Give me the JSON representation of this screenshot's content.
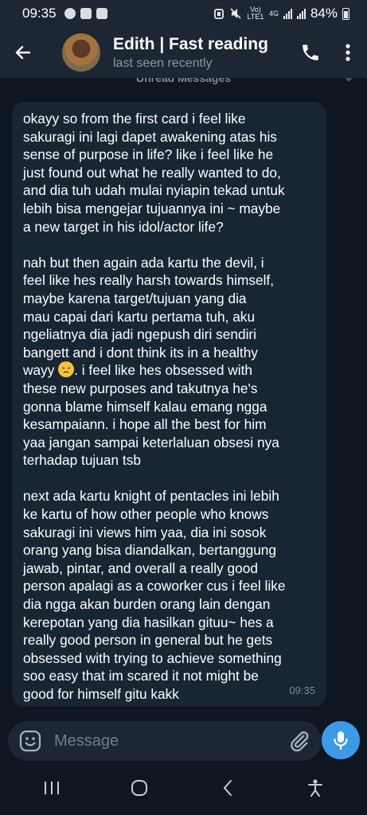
{
  "status_bar": {
    "time": "09:35",
    "network_label": "4G",
    "volte_label": "Vo) LTE1",
    "battery": "84%"
  },
  "header": {
    "title": "Edith | Fast reading",
    "subtitle": "last seen recently"
  },
  "chat": {
    "unread_banner": "Unread Messages",
    "message": {
      "paragraphs": [
        "okayy so from the first card i feel like\nsakuragi ini lagi dapet awakening atas his\nsense of purpose in life? like i feel like he\njust found out what he really wanted to do,\nand dia tuh udah mulai nyiapin tekad untuk\nlebih bisa mengejar tujuannya ini ~ maybe\na new target in his idol/actor life?",
        "nah but then again ada kartu the devil, i\nfeel like hes really harsh towards himself,\nmaybe karena target/tujuan yang dia\nmau capai dari kartu pertama tuh, aku\nngeliatnya dia jadi ngepush diri sendiri\nbangett and i dont think its in a healthy",
        "these new purposes and takutnya he's\ngonna blame himself kalau emang ngga\nkesampaiann. i hope all the best for him\nyaa jangan sampai keterlaluan obsesi nya\nterhadap tujuan tsb",
        "next ada kartu knight of pentacles ini lebih\nke kartu of how other people who knows\nsakuragi ini views him yaa, dia ini sosok\norang yang bisa diandalkan, bertanggung\njawab, pintar, and overall a really good\nperson apalagi as a coworker cus i feel like\ndia ngga akan burden orang lain dengan\nkerepotan yang dia hasilkan gituu~ hes a\nreally good person in general but he gets\nobsessed with trying to achieve something\nsoo easy that im scared it not might be\ngood for himself gitu kakk"
      ],
      "inline_before_emoji": "wayy ",
      "inline_after_emoji": ". i feel like hes obsessed with",
      "time": "09:35"
    }
  },
  "composer": {
    "placeholder": "Message"
  },
  "colors": {
    "accent": "#3e9ae8",
    "header_bg": "#1d2733",
    "chat_bg": "#0e1621",
    "bubble_bg": "#182533"
  },
  "icons": {
    "back": "arrow-left-icon",
    "call": "phone-icon",
    "menu": "more-vertical-icon",
    "emoji": "emoji-icon",
    "attach": "paperclip-icon",
    "mic": "microphone-icon"
  }
}
